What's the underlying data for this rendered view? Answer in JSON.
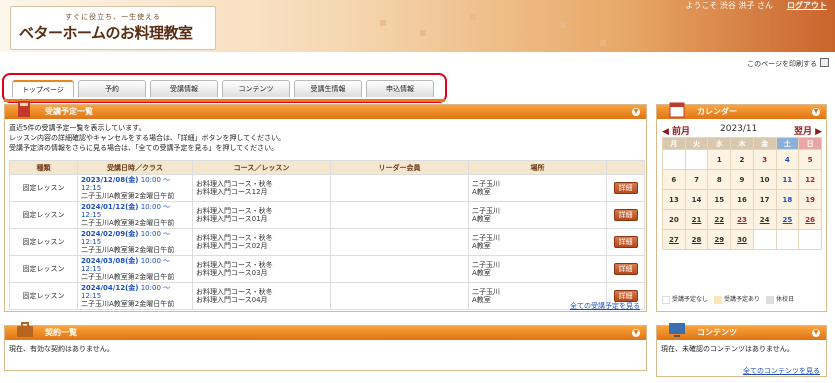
{
  "header": {
    "tagline": "すぐに役立ち、一生使える",
    "logo_text": "ベターホームのお料理教室",
    "welcome": "ようこそ 渋谷 洪子 さん",
    "logout": "ログアウト"
  },
  "print_label": "このページを印刷する",
  "tabs": [
    "トップページ",
    "予約",
    "受講情報",
    "コンテンツ",
    "受講生情報",
    "申込情報"
  ],
  "schedule": {
    "title": "受講予定一覧",
    "intro": [
      "直近5件の受講予定一覧を表示しています。",
      "レッスン内容の詳細確認やキャンセルをする場合は、「詳細」ボタンを押してください。",
      "受講予定済の情報をさらに見る場合は、「全ての受講予定を見る」を押してください。"
    ],
    "columns": [
      "種類",
      "受講日時／クラス",
      "コース／レッスン",
      "リーダー会員",
      "場所",
      ""
    ],
    "rows": [
      {
        "type": "固定レッスン",
        "date": "2023/12/08(金)",
        "time": "10:00 ～ 12:15",
        "cls": "二子玉川A教室第2金曜日午前",
        "course": "お料理入門コース・秋冬",
        "lesson": "お料理入門コース12月",
        "leader": "",
        "place1": "二子玉川",
        "place2": "A教室",
        "btn": "詳細"
      },
      {
        "type": "固定レッスン",
        "date": "2024/01/12(金)",
        "time": "10:00 ～ 12:15",
        "cls": "二子玉川A教室第2金曜日午前",
        "course": "お料理入門コース・秋冬",
        "lesson": "お料理入門コース01月",
        "leader": "",
        "place1": "二子玉川",
        "place2": "A教室",
        "btn": "詳細"
      },
      {
        "type": "固定レッスン",
        "date": "2024/02/09(金)",
        "time": "10:00 ～ 12:15",
        "cls": "二子玉川A教室第2金曜日午前",
        "course": "お料理入門コース・秋冬",
        "lesson": "お料理入門コース02月",
        "leader": "",
        "place1": "二子玉川",
        "place2": "A教室",
        "btn": "詳細"
      },
      {
        "type": "固定レッスン",
        "date": "2024/03/08(金)",
        "time": "10:00 ～ 12:15",
        "cls": "二子玉川A教室第2金曜日午前",
        "course": "お料理入門コース・秋冬",
        "lesson": "お料理入門コース03月",
        "leader": "",
        "place1": "二子玉川",
        "place2": "A教室",
        "btn": "詳細"
      },
      {
        "type": "固定レッスン",
        "date": "2024/04/12(金)",
        "time": "10:00 ～ 12:15",
        "cls": "二子玉川A教室第2金曜日午前",
        "course": "お料理入門コース・秋冬",
        "lesson": "お料理入門コース04月",
        "leader": "",
        "place1": "二子玉川",
        "place2": "A教室",
        "btn": "詳細"
      }
    ],
    "more": "全ての受講予定を見る"
  },
  "contract": {
    "title": "契約一覧",
    "text": "現在、有効な契約はありません。"
  },
  "calendar": {
    "title": "カレンダー",
    "prev": "◀ 前月",
    "month": "2023/11",
    "next": "翌月 ▶",
    "weekdays": [
      "月",
      "火",
      "水",
      "木",
      "金",
      "土",
      "日"
    ],
    "weeks": [
      [
        "",
        "",
        "1",
        "2",
        "3",
        "4",
        "5"
      ],
      [
        "6",
        "7",
        "8",
        "9",
        "10",
        "11",
        "12"
      ],
      [
        "13",
        "14",
        "15",
        "16",
        "17",
        "18",
        "19"
      ],
      [
        "20",
        "21",
        "22",
        "23",
        "24",
        "25",
        "26"
      ],
      [
        "27",
        "28",
        "29",
        "30",
        "",
        "",
        ""
      ]
    ],
    "legend": [
      "受講予定なし",
      "受講予定あり",
      "休校日"
    ]
  },
  "contents": {
    "title": "コンテンツ",
    "text": "現在、未確認のコンテンツはありません。",
    "more": "全てのコンテンツを見る"
  },
  "colors": {
    "accent": "#e07514",
    "highlight": "#e0001a",
    "link": "#1a4fbf"
  }
}
